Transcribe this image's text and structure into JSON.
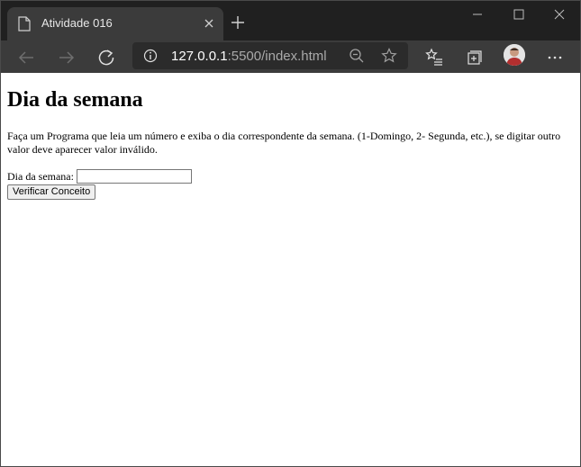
{
  "browser": {
    "tab": {
      "title": "Atividade 016"
    },
    "address": {
      "host": "127.0.0.1",
      "rest": ":5500/index.html"
    },
    "colors": {
      "chrome": "#202020",
      "toolbar": "#3b3b3b",
      "address_bg": "#2b2b2b",
      "icon": "#cfcfcf"
    }
  },
  "page": {
    "title": "Dia da semana",
    "description": "Faça um Programa que leia um número e exiba o dia correspondente da semana. (1-Domingo, 2- Segunda, etc.), se digitar outro valor deve aparecer valor inválido.",
    "form": {
      "label": "Dia da semana:",
      "input_value": "",
      "button_label": "Verificar Conceito"
    }
  }
}
